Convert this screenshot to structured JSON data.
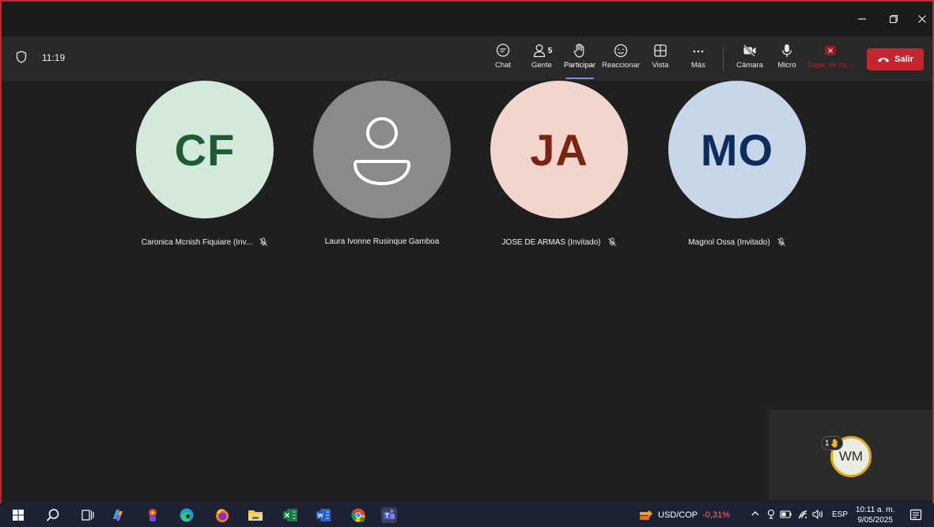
{
  "meeting": {
    "elapsed": "11:19"
  },
  "toolbar": {
    "chat": "Chat",
    "people": "Gente",
    "people_count": "5",
    "raise_hand": "Participar",
    "react": "Reaccionar",
    "view": "Vista",
    "more": "Más",
    "camera": "Cámara",
    "mic": "Micro",
    "stop_share": "Dejar de co...",
    "leave": "Salir"
  },
  "participants": [
    {
      "initials": "CF",
      "name": "Caronica Mcnish Fiquiare (Inv...",
      "muted": true,
      "bg": "#d3e9dc",
      "fg": "#1f5c34"
    },
    {
      "initials": "",
      "name": "Laura Ivonne Rusinque Gamboa",
      "muted": false,
      "bg": "#8a8a8a",
      "fg": "#ffffff"
    },
    {
      "initials": "JA",
      "name": "JOSE DE ARMAS (Invitado)",
      "muted": true,
      "bg": "#f2d5cc",
      "fg": "#7a2512"
    },
    {
      "initials": "MO",
      "name": "Magnol Ossa (Invitado)",
      "muted": true,
      "bg": "#c8d6ea",
      "fg": "#0f2d5c"
    }
  ],
  "self": {
    "initials": "WM",
    "raised_hands": "1"
  },
  "taskbar": {
    "ticker_symbol": "USD/COP",
    "ticker_change": "-0,31%",
    "language": "ESP",
    "time": "10:11 a. m.",
    "date": "9/05/2025"
  },
  "colors": {
    "accent": "#7f85f5",
    "leave": "#c4262e",
    "raise_hand": "#e3a70e"
  }
}
